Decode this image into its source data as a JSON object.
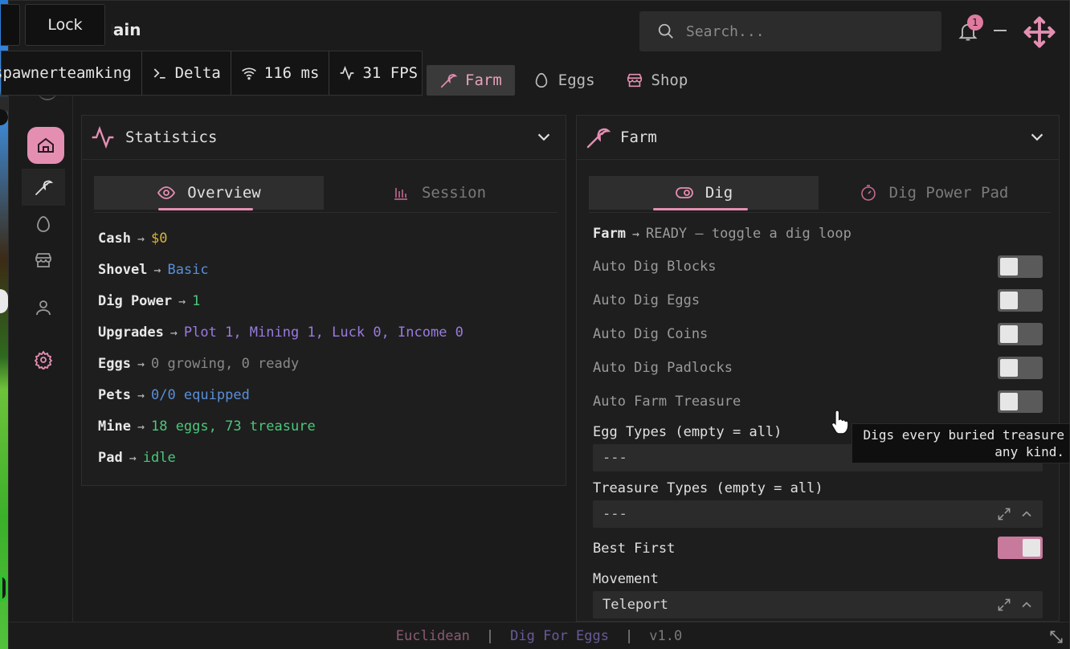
{
  "window": {
    "title": "Main"
  },
  "lock_tooltip": "Lock",
  "search": {
    "placeholder": "Search..."
  },
  "notifications": {
    "count": "1"
  },
  "statsbar": {
    "user": "spawnerteamking",
    "executor": "Delta",
    "ping": "116 ms",
    "fps": "31 FPS"
  },
  "top_tabs": [
    {
      "label": "Farm",
      "icon": "pickaxe-icon",
      "active": true
    },
    {
      "label": "Eggs",
      "icon": "egg-icon",
      "active": false
    },
    {
      "label": "Shop",
      "icon": "store-icon",
      "active": false
    }
  ],
  "nav": [
    "home-icon",
    "pickaxe-icon",
    "egg-icon",
    "store-icon",
    "user-icon",
    "gear-icon"
  ],
  "statistics": {
    "title": "Statistics",
    "tabs": [
      {
        "label": "Overview",
        "icon": "eye-icon"
      },
      {
        "label": "Session",
        "icon": "bar-chart-icon"
      }
    ],
    "rows": [
      {
        "key": "Cash",
        "value": "$0",
        "color": "#d8b43a"
      },
      {
        "key": "Shovel",
        "value": "Basic",
        "color": "#5a8fd8"
      },
      {
        "key": "Dig Power",
        "value": "1",
        "color": "#4cc77a"
      },
      {
        "key": "Upgrades",
        "value": "Plot 1, Mining 1, Luck 0, Income 0",
        "color": "#9a7ae0"
      },
      {
        "key": "Eggs",
        "value": "0 growing, 0 ready",
        "color": "#8a8a8a"
      },
      {
        "key": "Pets",
        "value": "0/0 equipped",
        "color": "#5a8fd8"
      },
      {
        "key": "Mine",
        "value": "18 eggs, 73 treasure",
        "color": "#4cc77a"
      },
      {
        "key": "Pad",
        "value": "idle",
        "color": "#4cc77a"
      }
    ]
  },
  "farm": {
    "title": "Farm",
    "tabs": [
      {
        "label": "Dig",
        "icon": "toggle-icon"
      },
      {
        "label": "Dig Power Pad",
        "icon": "timer-icon"
      }
    ],
    "status_key": "Farm",
    "status_value": "READY — toggle a dig loop",
    "toggles": [
      {
        "label": "Auto Dig Blocks",
        "on": false
      },
      {
        "label": "Auto Dig Eggs",
        "on": false
      },
      {
        "label": "Auto Dig Coins",
        "on": false
      },
      {
        "label": "Auto Dig Padlocks",
        "on": false
      },
      {
        "label": "Auto Farm Treasure",
        "on": false
      }
    ],
    "egg_types": {
      "label": "Egg Types (empty = all)",
      "value": "---"
    },
    "treasure_types": {
      "label": "Treasure Types (empty = all)",
      "value": "---"
    },
    "best_first": {
      "label": "Best First",
      "on": true
    },
    "movement": {
      "label": "Movement",
      "value": "Teleport"
    }
  },
  "tooltip": {
    "line1": "Digs every buried treasure",
    "line2": "any kind."
  },
  "footer": {
    "brand": "Euclidean",
    "game": "Dig For Eggs",
    "version": "v1.0"
  },
  "colors": {
    "accent": "#e48fb2",
    "bg": "#1b1b1b",
    "panel": "#1e1e1e"
  }
}
